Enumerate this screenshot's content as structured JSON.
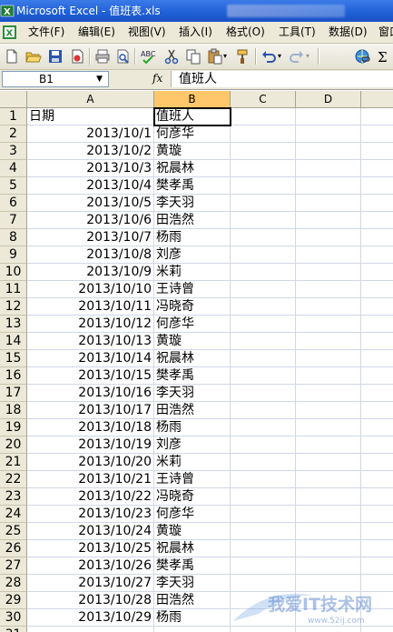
{
  "window": {
    "title": "Microsoft Excel - 值班表.xls"
  },
  "menu": [
    "文件(F)",
    "编辑(E)",
    "视图(V)",
    "插入(I)",
    "格式(O)",
    "工具(T)",
    "数据(D)",
    "窗口"
  ],
  "toolbar": {
    "icons": [
      "new-icon",
      "open-icon",
      "save-icon",
      "permission-icon",
      "print-icon",
      "print-preview-icon",
      "spelling-icon",
      "cut-icon",
      "copy-icon",
      "paste-icon",
      "format-painter-icon",
      "undo-icon",
      "redo-icon",
      "hyperlink-icon",
      "autosum-icon"
    ]
  },
  "formula_bar": {
    "name_box": "B1",
    "fx": "fx",
    "content": "值班人"
  },
  "columns": [
    "A",
    "B",
    "C",
    "D"
  ],
  "rows": [
    {
      "n": "1",
      "a": "日期",
      "b": "值班人"
    },
    {
      "n": "2",
      "a": "2013/10/1",
      "b": "何彦华"
    },
    {
      "n": "3",
      "a": "2013/10/2",
      "b": "黄璇"
    },
    {
      "n": "4",
      "a": "2013/10/3",
      "b": "祝晨林"
    },
    {
      "n": "5",
      "a": "2013/10/4",
      "b": "樊孝禹"
    },
    {
      "n": "6",
      "a": "2013/10/5",
      "b": "李天羽"
    },
    {
      "n": "7",
      "a": "2013/10/6",
      "b": "田浩然"
    },
    {
      "n": "8",
      "a": "2013/10/7",
      "b": "杨雨"
    },
    {
      "n": "9",
      "a": "2013/10/8",
      "b": "刘彦"
    },
    {
      "n": "10",
      "a": "2013/10/9",
      "b": "米莉"
    },
    {
      "n": "11",
      "a": "2013/10/10",
      "b": "王诗曾"
    },
    {
      "n": "12",
      "a": "2013/10/11",
      "b": "冯晓奇"
    },
    {
      "n": "13",
      "a": "2013/10/12",
      "b": "何彦华"
    },
    {
      "n": "14",
      "a": "2013/10/13",
      "b": "黄璇"
    },
    {
      "n": "15",
      "a": "2013/10/14",
      "b": "祝晨林"
    },
    {
      "n": "16",
      "a": "2013/10/15",
      "b": "樊孝禹"
    },
    {
      "n": "17",
      "a": "2013/10/16",
      "b": "李天羽"
    },
    {
      "n": "18",
      "a": "2013/10/17",
      "b": "田浩然"
    },
    {
      "n": "19",
      "a": "2013/10/18",
      "b": "杨雨"
    },
    {
      "n": "20",
      "a": "2013/10/19",
      "b": "刘彦"
    },
    {
      "n": "21",
      "a": "2013/10/20",
      "b": "米莉"
    },
    {
      "n": "22",
      "a": "2013/10/21",
      "b": "王诗曾"
    },
    {
      "n": "23",
      "a": "2013/10/22",
      "b": "冯晓奇"
    },
    {
      "n": "24",
      "a": "2013/10/23",
      "b": "何彦华"
    },
    {
      "n": "25",
      "a": "2013/10/24",
      "b": "黄璇"
    },
    {
      "n": "26",
      "a": "2013/10/25",
      "b": "祝晨林"
    },
    {
      "n": "27",
      "a": "2013/10/26",
      "b": "樊孝禹"
    },
    {
      "n": "28",
      "a": "2013/10/27",
      "b": "李天羽"
    },
    {
      "n": "29",
      "a": "2013/10/28",
      "b": "田浩然"
    },
    {
      "n": "30",
      "a": "2013/10/29",
      "b": "杨雨"
    },
    {
      "n": "31",
      "a": "",
      "b": ""
    }
  ],
  "watermark": {
    "text": "我爱IT技术网",
    "url": "www.52ij.com"
  }
}
